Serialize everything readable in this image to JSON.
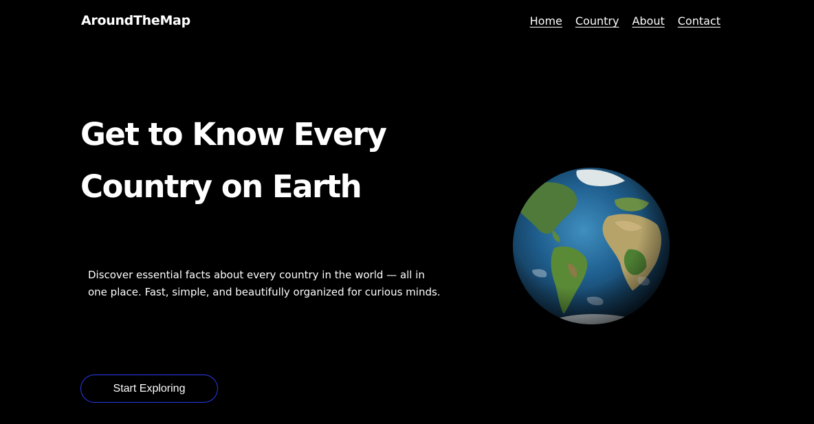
{
  "header": {
    "brand": "AroundTheMap",
    "nav": [
      {
        "label": "Home"
      },
      {
        "label": "Country"
      },
      {
        "label": "About"
      },
      {
        "label": "Contact"
      }
    ]
  },
  "hero": {
    "title_line1": "Get to Know Every",
    "title_line2": "Country on Earth",
    "description": "Discover essential facts about every country in the world — all in one place. Fast, simple, and beautifully organized for curious minds.",
    "cta_label": "Start Exploring"
  },
  "colors": {
    "background": "#000000",
    "text": "#ffffff",
    "cta_border": "#2a3cf0"
  },
  "icons": {
    "hero_image": "earth-globe-image"
  }
}
